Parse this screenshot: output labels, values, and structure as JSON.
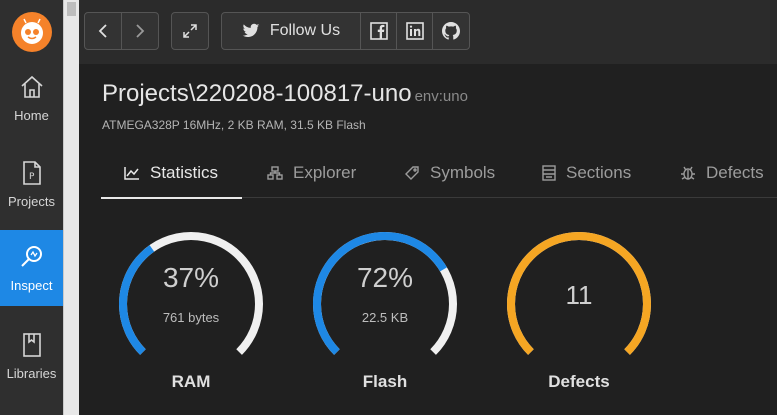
{
  "sidebar": {
    "items": [
      {
        "label": "Home",
        "icon": "home-icon"
      },
      {
        "label": "Projects",
        "icon": "file-icon"
      },
      {
        "label": "Inspect",
        "icon": "inspect-icon",
        "active": true
      },
      {
        "label": "Libraries",
        "icon": "book-icon"
      }
    ]
  },
  "toolbar": {
    "follow_label": "Follow Us"
  },
  "header": {
    "title": "Projects\\220208-100817-uno",
    "env": "env:uno",
    "subtitle": "ATMEGA328P 16MHz, 2 KB RAM, 31.5 KB Flash"
  },
  "tabs": [
    {
      "label": "Statistics",
      "active": true
    },
    {
      "label": "Explorer"
    },
    {
      "label": "Symbols"
    },
    {
      "label": "Sections"
    },
    {
      "label": "Defects"
    }
  ],
  "gauges": [
    {
      "label": "RAM",
      "percent_text": "37%",
      "detail": "761 bytes",
      "fill": 0.37,
      "color": "#1e88e5"
    },
    {
      "label": "Flash",
      "percent_text": "72%",
      "detail": "22.5 KB",
      "fill": 0.72,
      "color": "#1e88e5"
    },
    {
      "label": "Defects",
      "value": "11",
      "fill": 1.0,
      "color": "#f5a623"
    }
  ],
  "colors": {
    "accent": "#1e88e5",
    "warning": "#f5a623",
    "track": "#f0f0f0"
  }
}
